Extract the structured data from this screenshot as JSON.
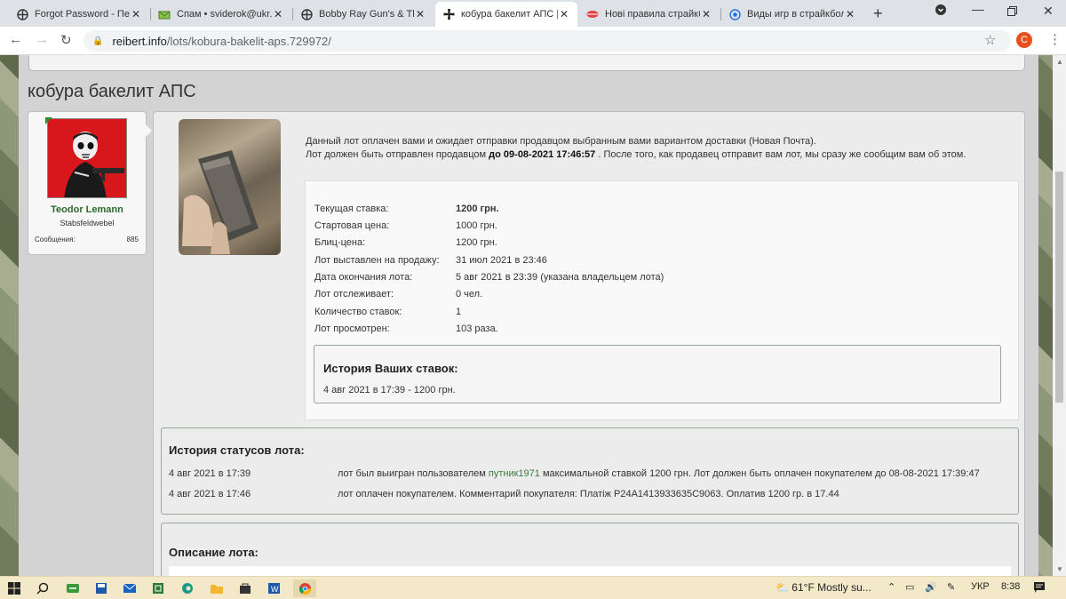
{
  "browser": {
    "tabs": [
      {
        "title": "Forgot Password - Пер",
        "icon": "reibert-icon"
      },
      {
        "title": "Спам • sviderok@ukr.",
        "icon": "mail-icon"
      },
      {
        "title": "Bobby Ray Gun's & Th",
        "icon": "reibert-icon"
      },
      {
        "title": "кобура бакелит АПС |",
        "icon": "iron-cross-icon",
        "active": true
      },
      {
        "title": "Нові правила страйкб",
        "icon": "lips-icon"
      },
      {
        "title": "Виды игр в страйкбол",
        "icon": "target-icon"
      }
    ],
    "new_tab": "+",
    "url_domain": "reibert.info",
    "url_path": "/lots/kobura-bakelit-aps.729972/",
    "profile_initial": "C"
  },
  "page": {
    "title": "кобура бакелит АПС"
  },
  "user": {
    "name": "Teodor Lemann",
    "rank": "Stabsfeldwebel",
    "messages_label": "Сообщения:",
    "messages_count": "885"
  },
  "notice": {
    "line1": "Данный лот оплачен вами и ожидает отправки продавцом выбранным вами вариантом доставки (Новая Почта).",
    "line2_pre": "Лот должен быть отправлен продавцом",
    "line2_bold": "до 09-08-2021 17:46:57",
    "line2_post": ". После того, как продавец отправит вам лот, мы сразу же сообщим вам об этом."
  },
  "lot_info": [
    {
      "label": "Текущая ставка:",
      "value": "1200 грн.",
      "bold": true
    },
    {
      "label": "Стартовая цена:",
      "value": "1000 грн."
    },
    {
      "label": "Блиц-цена:",
      "value": "1200 грн."
    },
    {
      "label": "Лот выставлен на продажу:",
      "value": "31 июл 2021 в 23:46"
    },
    {
      "label": "Дата окончания лота:",
      "value": "5 авг 2021 в 23:39 (указана владельцем лота)"
    },
    {
      "label": "Лот отслеживает:",
      "value": "0 чел."
    },
    {
      "label": "Количество ставок:",
      "value": "1"
    },
    {
      "label": "Лот просмотрен:",
      "value": "103 раза."
    }
  ],
  "bid_history": {
    "title": "История Ваших ставок:",
    "entry": "4 авг 2021 в 17:39 - 1200 грн."
  },
  "status_history": {
    "title": "История статусов лота:",
    "rows": [
      {
        "date": "4 авг 2021 в 17:39",
        "pre": "лот был выигран пользователем ",
        "user": "путник1971",
        "post": " максимальной ставкой 1200 грн. Лот должен быть оплачен покупателем до 08-08-2021 17:39:47"
      },
      {
        "date": "4 авг 2021 в 17:46",
        "pre": "лот оплачен покупателем. Комментарий покупателя: Платіж P24A1413933635C9063. Оплатив 1200 гр. в 17.44",
        "user": "",
        "post": ""
      }
    ]
  },
  "description": {
    "title": "Описание лота:"
  },
  "taskbar": {
    "weather": "61°F  Mostly su...",
    "lang": "УКР",
    "time": "8:38"
  },
  "colors": {
    "user_name": "#2a6a2a",
    "link": "#3b7a3b",
    "avatar_bg": "#d7171b",
    "taskbar_bg": "#f3e9c9"
  }
}
